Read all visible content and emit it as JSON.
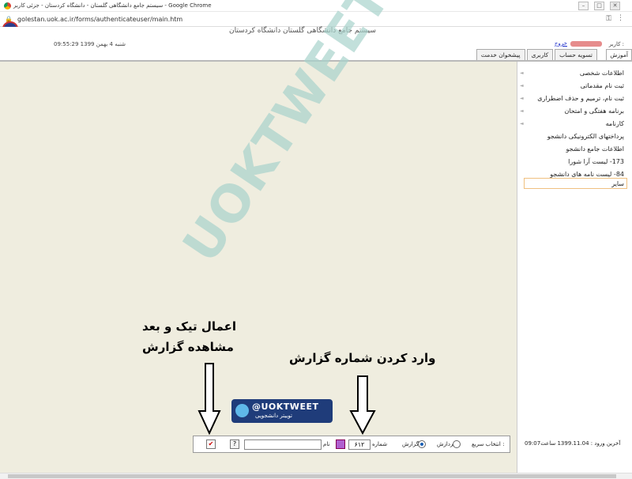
{
  "browser": {
    "window_title": "سیستم جامع دانشگاهی گلستان - دانشگاه کردستان - جزئی کاربر - Google Chrome",
    "url": "golestan.uok.ac.ir/forms/authenticateuser/main.htm"
  },
  "header": {
    "system_title": "سیستم جامع دانشگاهی گلستان   دانشگاه کردستان",
    "datetime": "09:55:29 شنبه 4 بهمن 1399",
    "user_label": "کاربر :",
    "logout_label": "خروج"
  },
  "tabs": [
    "پیشخوان خدمت",
    "کاربری",
    "تسویه حساب",
    "آموزش"
  ],
  "sidebar": {
    "items": [
      "اطلاعات شخصی",
      "ثبت نام مقدماتی",
      "ثبت نام، ترمیم و حذف اضطراری",
      "برنامه هفتگی و امتحان",
      "کارنامه",
      "پرداختهای الکترونیکی دانشجو",
      "اطلاعات جامع دانشجو",
      "173- لیست آرا شورا",
      "84- لیست نامه های دانشجو",
      "سایر"
    ]
  },
  "watermark": "UOKTWEET",
  "annotations": {
    "tick_line1": "اعمال تیک و بعد",
    "tick_line2": "مشاهده گزارش",
    "report_number": "وارد کردن شماره گزارش"
  },
  "badge": {
    "handle": "@UOKTWEET",
    "subtitle": "توییتر دانشجویی"
  },
  "quick_select": {
    "label": "انتخاب سریع :",
    "option_process": "پردازش",
    "option_report": "گزارش",
    "selected": "گزارش",
    "number_label": "شماره",
    "number_value": "۶۱۲",
    "name_label": "نام",
    "name_value": ""
  },
  "footer": {
    "last_login": "آخرین ورود : 1399.11.04 ساعت09:07"
  },
  "colors": {
    "workspace": "#efeddf",
    "watermark": "#a9d3cc",
    "badge": "#1f3c7a"
  }
}
